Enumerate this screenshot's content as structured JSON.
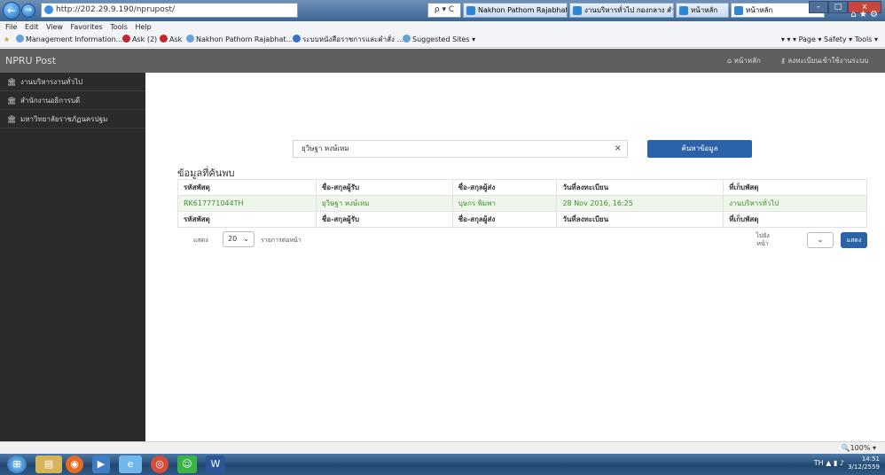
{
  "browser": {
    "url": "http://202.29.9.190/nprupost/",
    "search_hint": "ρ ▾ C",
    "tabs": [
      {
        "label": "Nakhon Pathom Rajabhat..."
      },
      {
        "label": "งานบริหารทั่วไป กองกลาง สำ..."
      },
      {
        "label": "หน้าหลัก"
      },
      {
        "label": "หน้าหลัก"
      }
    ],
    "menu": [
      "File",
      "Edit",
      "View",
      "Favorites",
      "Tools",
      "Help"
    ],
    "favorites": [
      {
        "label": "Management Information..."
      },
      {
        "label": "Ask (2)"
      },
      {
        "label": "Ask"
      },
      {
        "label": "Nakhon Pathom Rajabhat..."
      },
      {
        "label": "ระบบหนังสือราชการและคำสั่ง ..."
      },
      {
        "label": "Suggested Sites ▾"
      }
    ],
    "commands": "▾  ▾  ▾  Page ▾  Safety ▾  Tools ▾",
    "zoom": "100%"
  },
  "site": {
    "brand": "NPRU Post",
    "nav_home": "หน้าหลัก",
    "nav_register": "ลงทะเบียนเข้าใช้งานระบบ"
  },
  "sidebar": {
    "items": [
      {
        "label": "งานบริหารงานทั่วไป"
      },
      {
        "label": "สำนักงานอธิการบดี"
      },
      {
        "label": "มหาวิทยาลัยราชภัฏนครปฐม"
      }
    ]
  },
  "search": {
    "value": "ยุวิษฐา หงษ์เหม",
    "button": "ค้นหาข้อมูล"
  },
  "results": {
    "title": "ข้อมูลที่ค้นพบ",
    "headers": [
      "รหัสพัสดุ",
      "ชื่อ-สกุลผู้รับ",
      "ชื่อ-สกุลผู้ส่ง",
      "วันที่ลงทะเบียน",
      "ที่เก็บพัสดุ"
    ],
    "rows": [
      [
        "RK617771044TH",
        "ยุวิษฐา หงษ์เหม",
        "บุษกร พิมพา",
        "28 Nov 2016, 16:25",
        "งานบริหารทั่วไป"
      ]
    ]
  },
  "pager": {
    "show_label": "แสดง",
    "per_page": "20",
    "per_page_suffix": "รายการต่อหน้า",
    "goto_label": "ไปยังหน้า",
    "show_button": "แสดง"
  },
  "taskbar": {
    "lang": "TH",
    "time": "14:51",
    "date": "3/12/2559"
  }
}
